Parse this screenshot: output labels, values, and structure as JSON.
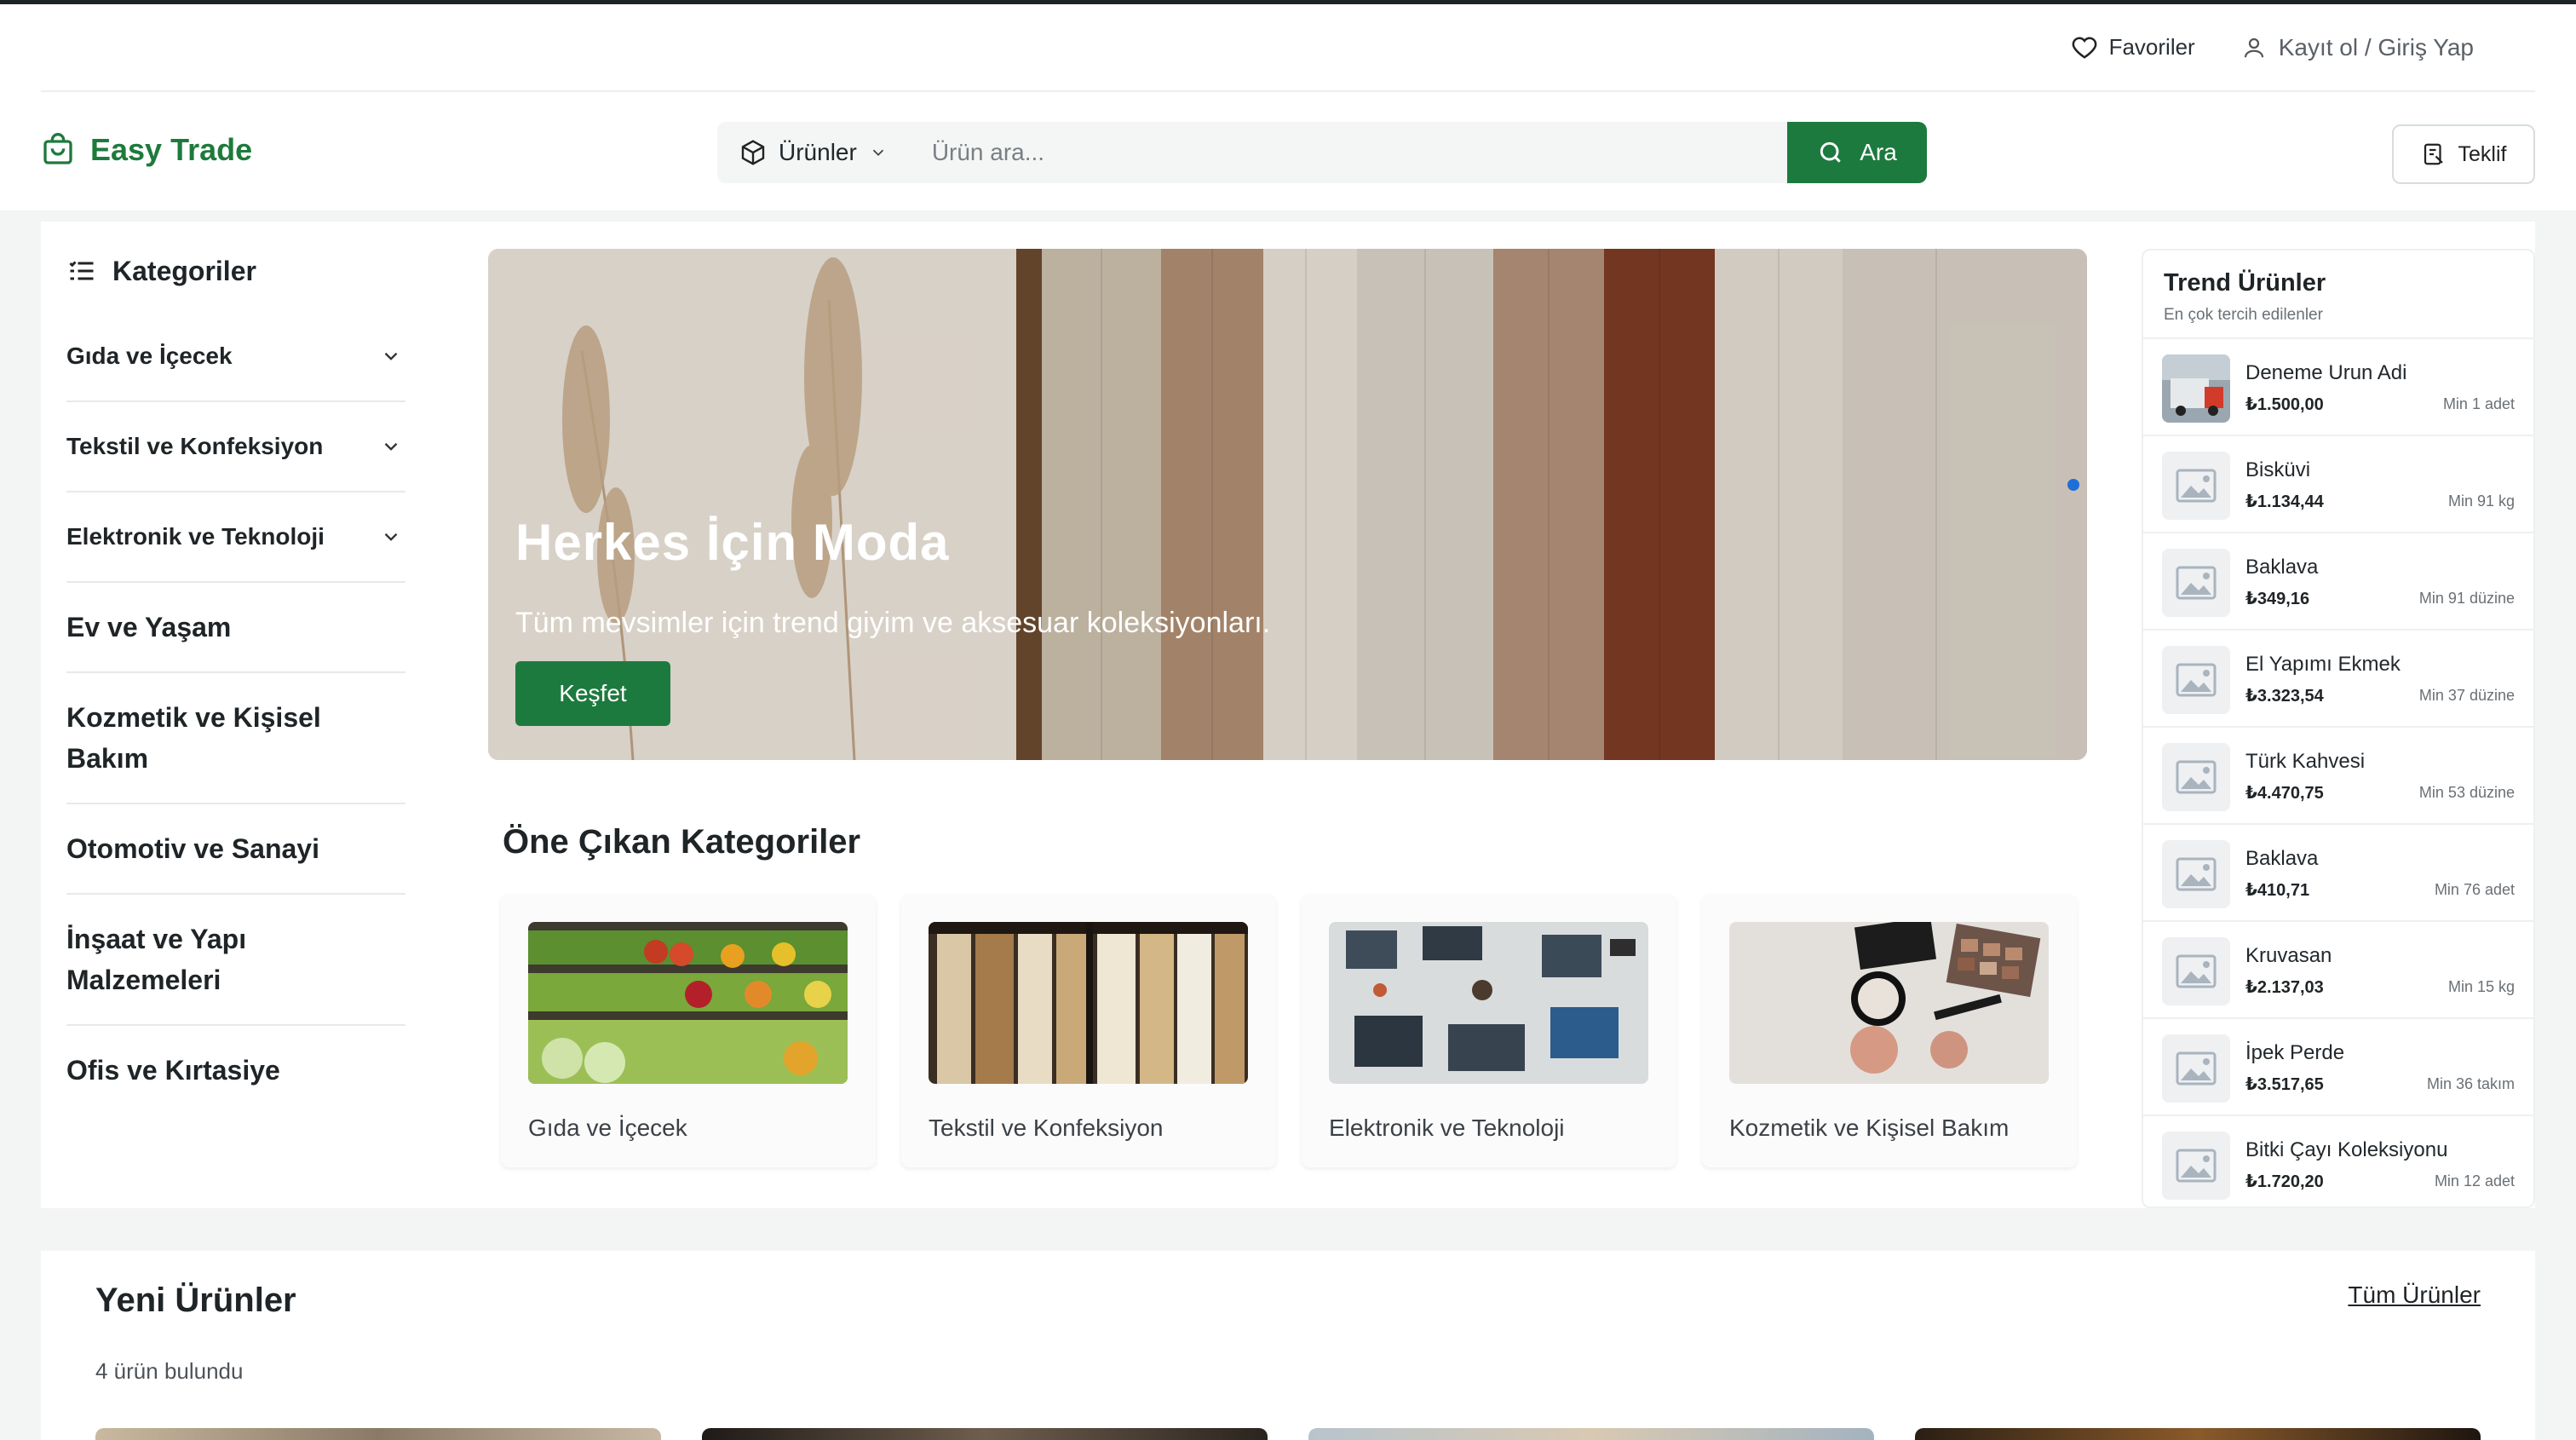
{
  "header": {
    "favorites_label": "Favoriler",
    "auth_label": "Kayıt ol / Giriş Yap",
    "brand": "Easy Trade",
    "search": {
      "category_label": "Ürünler",
      "placeholder": "Ürün ara...",
      "button_label": "Ara"
    },
    "offer_label": "Teklif"
  },
  "sidebar": {
    "title": "Kategoriler",
    "items": [
      {
        "label": "Gıda ve İçecek",
        "expandable": true
      },
      {
        "label": "Tekstil ve Konfeksiyon",
        "expandable": true
      },
      {
        "label": "Elektronik ve Teknoloji",
        "expandable": true
      },
      {
        "label": "Ev ve Yaşam",
        "expandable": false
      },
      {
        "label": "Kozmetik ve Kişisel Bakım",
        "expandable": false
      },
      {
        "label": "Otomotiv ve Sanayi",
        "expandable": false
      },
      {
        "label": "İnşaat ve Yapı Malzemeleri",
        "expandable": false
      },
      {
        "label": "Ofis ve Kırtasiye",
        "expandable": false
      }
    ]
  },
  "hero": {
    "title": "Herkes İçin Moda",
    "subtitle": "Tüm mevsimler için trend giyim ve aksesuar koleksiyonları.",
    "button_label": "Keşfet"
  },
  "featured": {
    "title": "Öne Çıkan Kategoriler",
    "cards": [
      {
        "label": "Gıda ve İçecek"
      },
      {
        "label": "Tekstil ve Konfeksiyon"
      },
      {
        "label": "Elektronik ve Teknoloji"
      },
      {
        "label": "Kozmetik ve Kişisel Bakım"
      }
    ]
  },
  "trend": {
    "title": "Trend Ürünler",
    "subtitle": "En çok tercih edilenler",
    "items": [
      {
        "name": "Deneme Urun Adi",
        "price": "₺1.500,00",
        "min": "Min 1 adet"
      },
      {
        "name": "Bisküvi",
        "price": "₺1.134,44",
        "min": "Min 91 kg"
      },
      {
        "name": "Baklava",
        "price": "₺349,16",
        "min": "Min 91 düzine"
      },
      {
        "name": "El Yapımı Ekmek",
        "price": "₺3.323,54",
        "min": "Min 37 düzine"
      },
      {
        "name": "Türk Kahvesi",
        "price": "₺4.470,75",
        "min": "Min 53 düzine"
      },
      {
        "name": "Baklava",
        "price": "₺410,71",
        "min": "Min 76 adet"
      },
      {
        "name": "Kruvasan",
        "price": "₺2.137,03",
        "min": "Min 15 kg"
      },
      {
        "name": "İpek Perde",
        "price": "₺3.517,65",
        "min": "Min 36 takım"
      },
      {
        "name": "Bitki Çayı Koleksiyonu",
        "price": "₺1.720,20",
        "min": "Min 12 adet"
      }
    ]
  },
  "new_products": {
    "title": "Yeni Ürünler",
    "count_text": "4 ürün bulundu",
    "all_link": "Tüm Ürünler"
  },
  "colors": {
    "brand_green": "#1d7a3e",
    "slider_dot": "#1e6fd9"
  }
}
